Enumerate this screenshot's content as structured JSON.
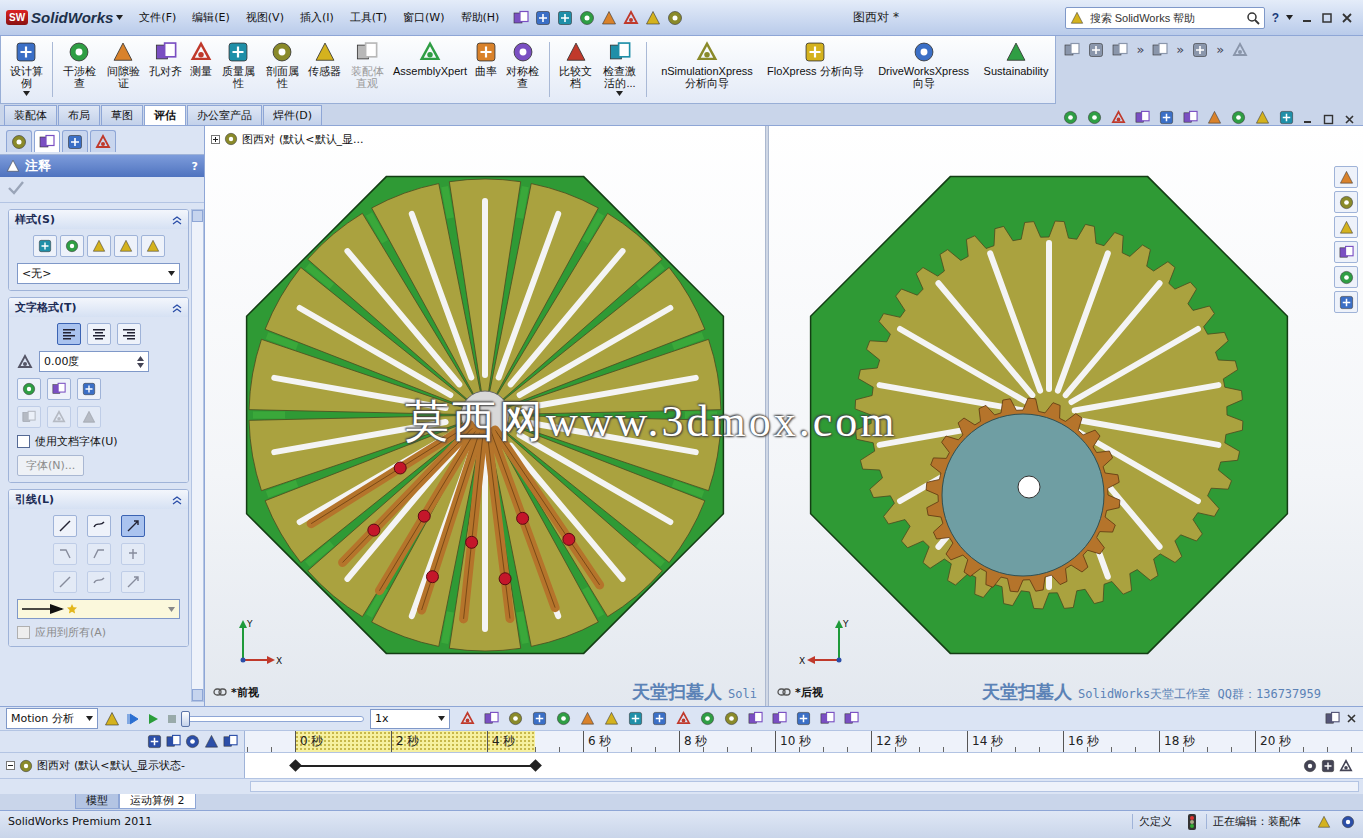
{
  "title_bar": {
    "logo_badge": "SW",
    "logo": "SolidWorks",
    "menus": [
      "文件(F)",
      "编辑(E)",
      "视图(V)",
      "插入(I)",
      "工具(T)",
      "窗口(W)",
      "帮助(H)"
    ],
    "document_title": "图西对 *",
    "search_placeholder": "搜索 SolidWorks 帮助",
    "help_button": "?"
  },
  "ribbon": {
    "buttons": [
      {
        "label": "设计算例",
        "disabled": false,
        "dropdown": true
      },
      {
        "label": "干涉检查",
        "disabled": false,
        "dropdown": false
      },
      {
        "label": "间隙验证",
        "disabled": false,
        "dropdown": false
      },
      {
        "label": "孔对齐",
        "disabled": false,
        "dropdown": false
      },
      {
        "label": "测量",
        "disabled": false,
        "dropdown": false
      },
      {
        "label": "质量属性",
        "disabled": false,
        "dropdown": false
      },
      {
        "label": "剖面属性",
        "disabled": false,
        "dropdown": false
      },
      {
        "label": "传感器",
        "disabled": false,
        "dropdown": false
      },
      {
        "label": "装配体直观",
        "disabled": true,
        "dropdown": false
      },
      {
        "label": "AssemblyXpert",
        "disabled": false,
        "dropdown": false
      },
      {
        "label": "曲率",
        "disabled": false,
        "dropdown": false
      },
      {
        "label": "对称检查",
        "disabled": false,
        "dropdown": false
      },
      {
        "label": "比较文档",
        "disabled": false,
        "dropdown": false
      },
      {
        "label": "检查激活的...",
        "disabled": false,
        "dropdown": true
      },
      {
        "label": "nSimulationXpress 分析向导",
        "disabled": false,
        "dropdown": false
      },
      {
        "label": "FloXpress 分析向导",
        "disabled": false,
        "dropdown": false
      },
      {
        "label": "DriveWorksXpress 向导",
        "disabled": false,
        "dropdown": false
      },
      {
        "label": "Sustainability",
        "disabled": false,
        "dropdown": false
      }
    ],
    "overflow": "»"
  },
  "command_tabs": [
    {
      "label": "装配体",
      "selected": false
    },
    {
      "label": "布局",
      "selected": false
    },
    {
      "label": "草图",
      "selected": false
    },
    {
      "label": "评估",
      "selected": true
    },
    {
      "label": "办公室产品",
      "selected": false
    },
    {
      "label": "焊件(D)",
      "selected": false
    }
  ],
  "property_manager": {
    "panel_tabs": [
      {
        "selected": false
      },
      {
        "selected": true
      },
      {
        "selected": false
      },
      {
        "selected": false
      }
    ],
    "title": "注释",
    "help": "?",
    "style_section": {
      "title": "样式(S)",
      "expanded": true,
      "value": "<无>"
    },
    "text_format_section": {
      "title": "文字格式(T)",
      "expanded": true,
      "align_buttons": [
        {
          "selected": true
        },
        {
          "selected": false
        },
        {
          "selected": false
        }
      ],
      "angle": "0.00度",
      "use_doc_font": {
        "label": "使用文档字体(U)",
        "checked": false
      },
      "font_button": {
        "label": "字体(N)...",
        "disabled": true
      }
    },
    "leader_section": {
      "title": "引线(L)",
      "expanded": true,
      "leader_buttons": [
        {
          "selected": false,
          "disabled": false
        },
        {
          "selected": false,
          "disabled": false
        },
        {
          "selected": true,
          "disabled": false
        },
        {
          "selected": false,
          "disabled": true
        },
        {
          "selected": false,
          "disabled": true
        },
        {
          "selected": false,
          "disabled": true
        },
        {
          "selected": false,
          "disabled": true
        },
        {
          "selected": false,
          "disabled": true
        },
        {
          "selected": false,
          "disabled": true
        }
      ],
      "apply_all": {
        "label": "应用到所有(A)",
        "checked": false,
        "disabled": true
      }
    }
  },
  "tree_root": {
    "name": "图西对",
    "config": "(默认<默认_显..."
  },
  "viewports": [
    {
      "name": "*前视",
      "axis_x": "X",
      "axis_y": "Y",
      "mirrored": false,
      "credit_author": "天堂扫墓人",
      "credit_suffix": "Soli"
    },
    {
      "name": "*后视",
      "axis_x": "X",
      "axis_y": "Y",
      "mirrored": true,
      "credit_author": "天堂扫墓人",
      "credit_suffix": "SolidWorks天堂工作室 QQ群：136737959"
    }
  ],
  "watermark": "莫西网www.3dmox.com",
  "motion": {
    "study_type": "Motion 分析",
    "speed": "1x",
    "playback_level": 0,
    "ticks": [
      "0 秒",
      "2 秒",
      "4 秒",
      "6 秒",
      "8 秒",
      "10 秒",
      "12 秒",
      "14 秒",
      "16 秒",
      "18 秒",
      "20 秒"
    ],
    "duration_level": 0.25,
    "tree_row": {
      "name": "图西对",
      "config": "(默认<默认_显示状态-",
      "expanded": true
    }
  },
  "bottom_tabs": [
    {
      "label": "模型",
      "selected": false
    },
    {
      "label": "运动算例 2",
      "selected": true
    }
  ],
  "status_bar": {
    "product": "SolidWorks Premium 2011",
    "state": "欠定义",
    "editing": "正在编辑：装配体"
  }
}
